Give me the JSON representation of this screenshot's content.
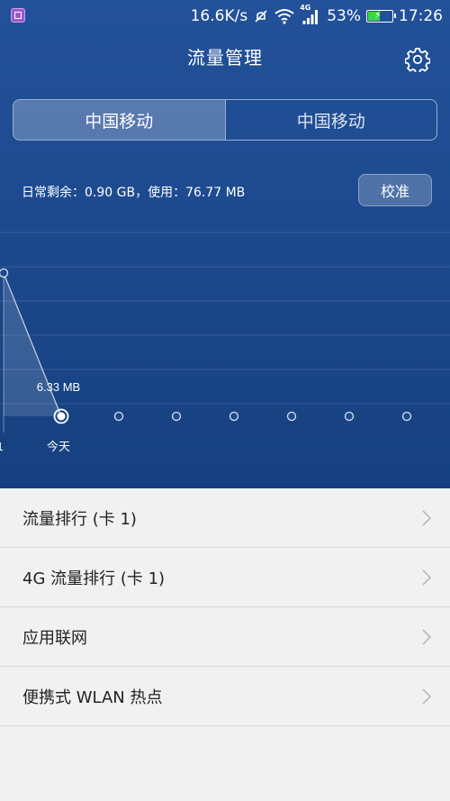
{
  "status_bar": {
    "speed": "16.6K/s",
    "network": "4G",
    "battery": "53%",
    "battery_level": 0.53,
    "time": "17:26"
  },
  "header": {
    "title": "流量管理",
    "settings_icon": "gear-icon"
  },
  "sim_tabs": [
    {
      "label": "中国移动",
      "selected": true
    },
    {
      "label": "中国移动",
      "selected": false
    }
  ],
  "usage_text": "日常剩余：0.90 GB，使用：76.77 MB",
  "calibrate_label": "校准",
  "chart_data": {
    "type": "line",
    "x": [
      "1",
      "今天",
      "",
      "",
      "",
      "",
      "",
      ""
    ],
    "values_mb": [
      null,
      6.33,
      null,
      null,
      null,
      null,
      null,
      null
    ],
    "point_label": "6.33 MB",
    "first_day_label": "1",
    "today_label": "今天",
    "grid": true
  },
  "menu": [
    {
      "label": "流量排行 (卡 1)"
    },
    {
      "label": "4G 流量排行 (卡 1)"
    },
    {
      "label": "应用联网"
    },
    {
      "label": "便携式 WLAN 热点"
    }
  ],
  "colors": {
    "header_bg": "#1d4a8e",
    "list_bg": "#f0f1f0",
    "battery_fill": "#3dd34a"
  }
}
